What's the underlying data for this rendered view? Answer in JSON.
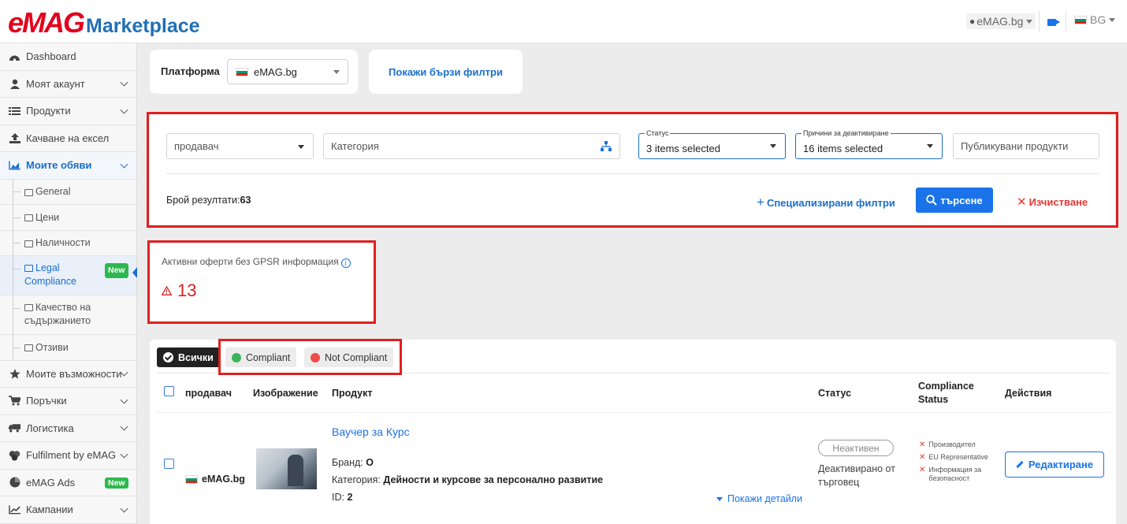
{
  "brand": {
    "logo_main": "eMAG",
    "logo_sub": "Marketplace"
  },
  "topbar": {
    "site": "eMAG.bg",
    "language": "BG"
  },
  "sidebar": {
    "items": [
      {
        "label": "Dashboard",
        "icon": "dashboard-icon"
      },
      {
        "label": "Моят акаунт",
        "icon": "user-icon"
      },
      {
        "label": "Продукти",
        "icon": "list-icon"
      },
      {
        "label": "Качване на ексел",
        "icon": "upload-icon"
      },
      {
        "label": "Моите обяви",
        "icon": "area-chart-icon"
      }
    ],
    "subitems": [
      {
        "label": "General"
      },
      {
        "label": "Цени"
      },
      {
        "label": "Наличности"
      },
      {
        "label": "Legal Compliance",
        "badge": "New"
      },
      {
        "label": "Качество на съдържанието"
      },
      {
        "label": "Отзиви"
      }
    ],
    "items_after": [
      {
        "label": "Моите възможности",
        "icon": "star-icon"
      },
      {
        "label": "Поръчки",
        "icon": "cart-icon"
      },
      {
        "label": "Логистика",
        "icon": "truck-icon"
      },
      {
        "label": "Fulfilment by eMAG",
        "icon": "boxes-icon"
      },
      {
        "label": "eMAG Ads",
        "icon": "pie-icon",
        "badge": "New"
      },
      {
        "label": "Кампании",
        "icon": "line-chart-icon"
      }
    ]
  },
  "platform": {
    "label": "Платформа",
    "value": "eMAG.bg"
  },
  "quick_filters": "Покажи бързи филтри",
  "filters": {
    "vendor_placeholder": "продавач",
    "category_placeholder": "Категория",
    "status_label": "Статус",
    "status_value": "3 items selected",
    "reasons_label": "Причини за деактивиране",
    "reasons_value": "16 items selected",
    "published_placeholder": "Публикувани продукти",
    "results_label": "Брой резултати:",
    "results_count": "63",
    "specialized": "Специализирани филтри",
    "search": "търсене",
    "clear": "Изчистване"
  },
  "gpsr": {
    "title": "Активни оферти без GPSR информация",
    "count": "13"
  },
  "tabs": {
    "all": "Всички",
    "compliant": "Compliant",
    "not_compliant": "Not Compliant"
  },
  "columns": {
    "vendor": "продавач",
    "image": "Изображение",
    "product": "Продукт",
    "status": "Статус",
    "compliance_1": "Compliance",
    "compliance_2": "Status",
    "actions": "Действия"
  },
  "row": {
    "vendor": "eMAG.bg",
    "title": "Ваучер за Курс",
    "brand_label": "Бранд:",
    "brand_value": "O",
    "category_label": "Категория:",
    "category_value": "Дейности и курсове за персонално развитие",
    "id_label": "ID:",
    "id_value": "2",
    "details": "Покажи детайли",
    "status": "Неактивен",
    "status_sub": "Деактивирано от търговец",
    "compliance": [
      "Производител",
      "EU Representative",
      "Информация за безопасност"
    ],
    "edit": "Редактиране"
  },
  "colors": {
    "accent": "#1a73e8",
    "brand_red": "#e3001b",
    "alert_red": "#e01f1f",
    "success": "#2db84d"
  }
}
